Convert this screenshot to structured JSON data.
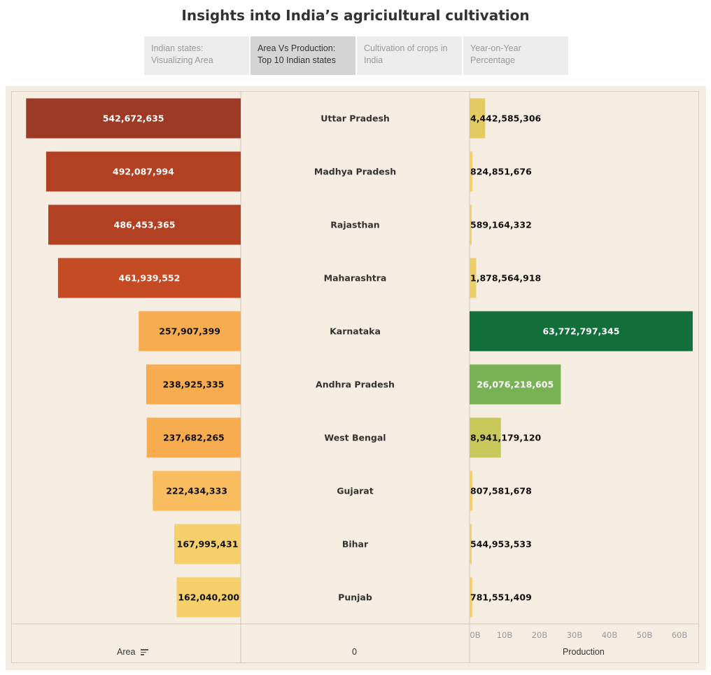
{
  "header": {
    "title": "Insights into India’s agriciultural cultivation"
  },
  "tabs": [
    {
      "line1": "Indian states:",
      "line2": "Visualizing Area",
      "active": false
    },
    {
      "line1": "Area Vs Production:",
      "line2": "Top 10 Indian states",
      "active": true
    },
    {
      "line1": "Cultivation of crops in",
      "line2": "India",
      "active": false
    },
    {
      "line1": "Year-on-Year",
      "line2": "Percentage",
      "active": false
    }
  ],
  "footer": {
    "area_label": "Area",
    "center_label": "0",
    "production_label": "Production"
  },
  "chart_data": {
    "type": "bar",
    "categories": [
      "Uttar Pradesh",
      "Madhya Pradesh",
      "Rajasthan",
      "Maharashtra",
      "Karnataka",
      "Andhra Pradesh",
      "West Bengal",
      "Gujarat",
      "Bihar",
      "Punjab"
    ],
    "series": [
      {
        "name": "Area",
        "values": [
          542672635,
          492087994,
          486453365,
          461939552,
          257907399,
          238925335,
          237682265,
          222434333,
          167995431,
          162040200
        ],
        "labels": [
          "542,672,635",
          "492,087,994",
          "486,453,365",
          "461,939,552",
          "257,907,399",
          "238,925,335",
          "237,682,265",
          "222,434,333",
          "167,995,431",
          "162,040,200"
        ],
        "colors": [
          "#9c3a25",
          "#b24123",
          "#b24123",
          "#c44b23",
          "#f8ac50",
          "#f8ac50",
          "#f8ac50",
          "#f9bd60",
          "#f5d06a",
          "#f5d06a"
        ]
      },
      {
        "name": "Production",
        "values": [
          4442585306,
          824851676,
          589164332,
          1878564918,
          63772797345,
          26076218605,
          8941179120,
          807581678,
          544953533,
          781551409
        ],
        "labels": [
          "4,442,585,306",
          "824,851,676",
          "589,164,332",
          "1,878,564,918",
          "63,772,797,345",
          "26,076,218,605",
          "8,941,179,120",
          "807,581,678",
          "544,953,533",
          "781,551,409"
        ],
        "colors": [
          "#e3cb63",
          "#f4d06a",
          "#f4d06a",
          "#edcf67",
          "#136f3a",
          "#79b155",
          "#c8c85b",
          "#f4d06a",
          "#f4d06a",
          "#f4d06a"
        ]
      }
    ],
    "area_max": 552000000,
    "production_ticks": [
      "0B",
      "10B",
      "20B",
      "30B",
      "40B",
      "50B",
      "60B"
    ],
    "production_tick_values": [
      0,
      10000000000,
      20000000000,
      30000000000,
      40000000000,
      50000000000,
      60000000000
    ],
    "xlim_production": [
      0,
      64000000000
    ]
  }
}
